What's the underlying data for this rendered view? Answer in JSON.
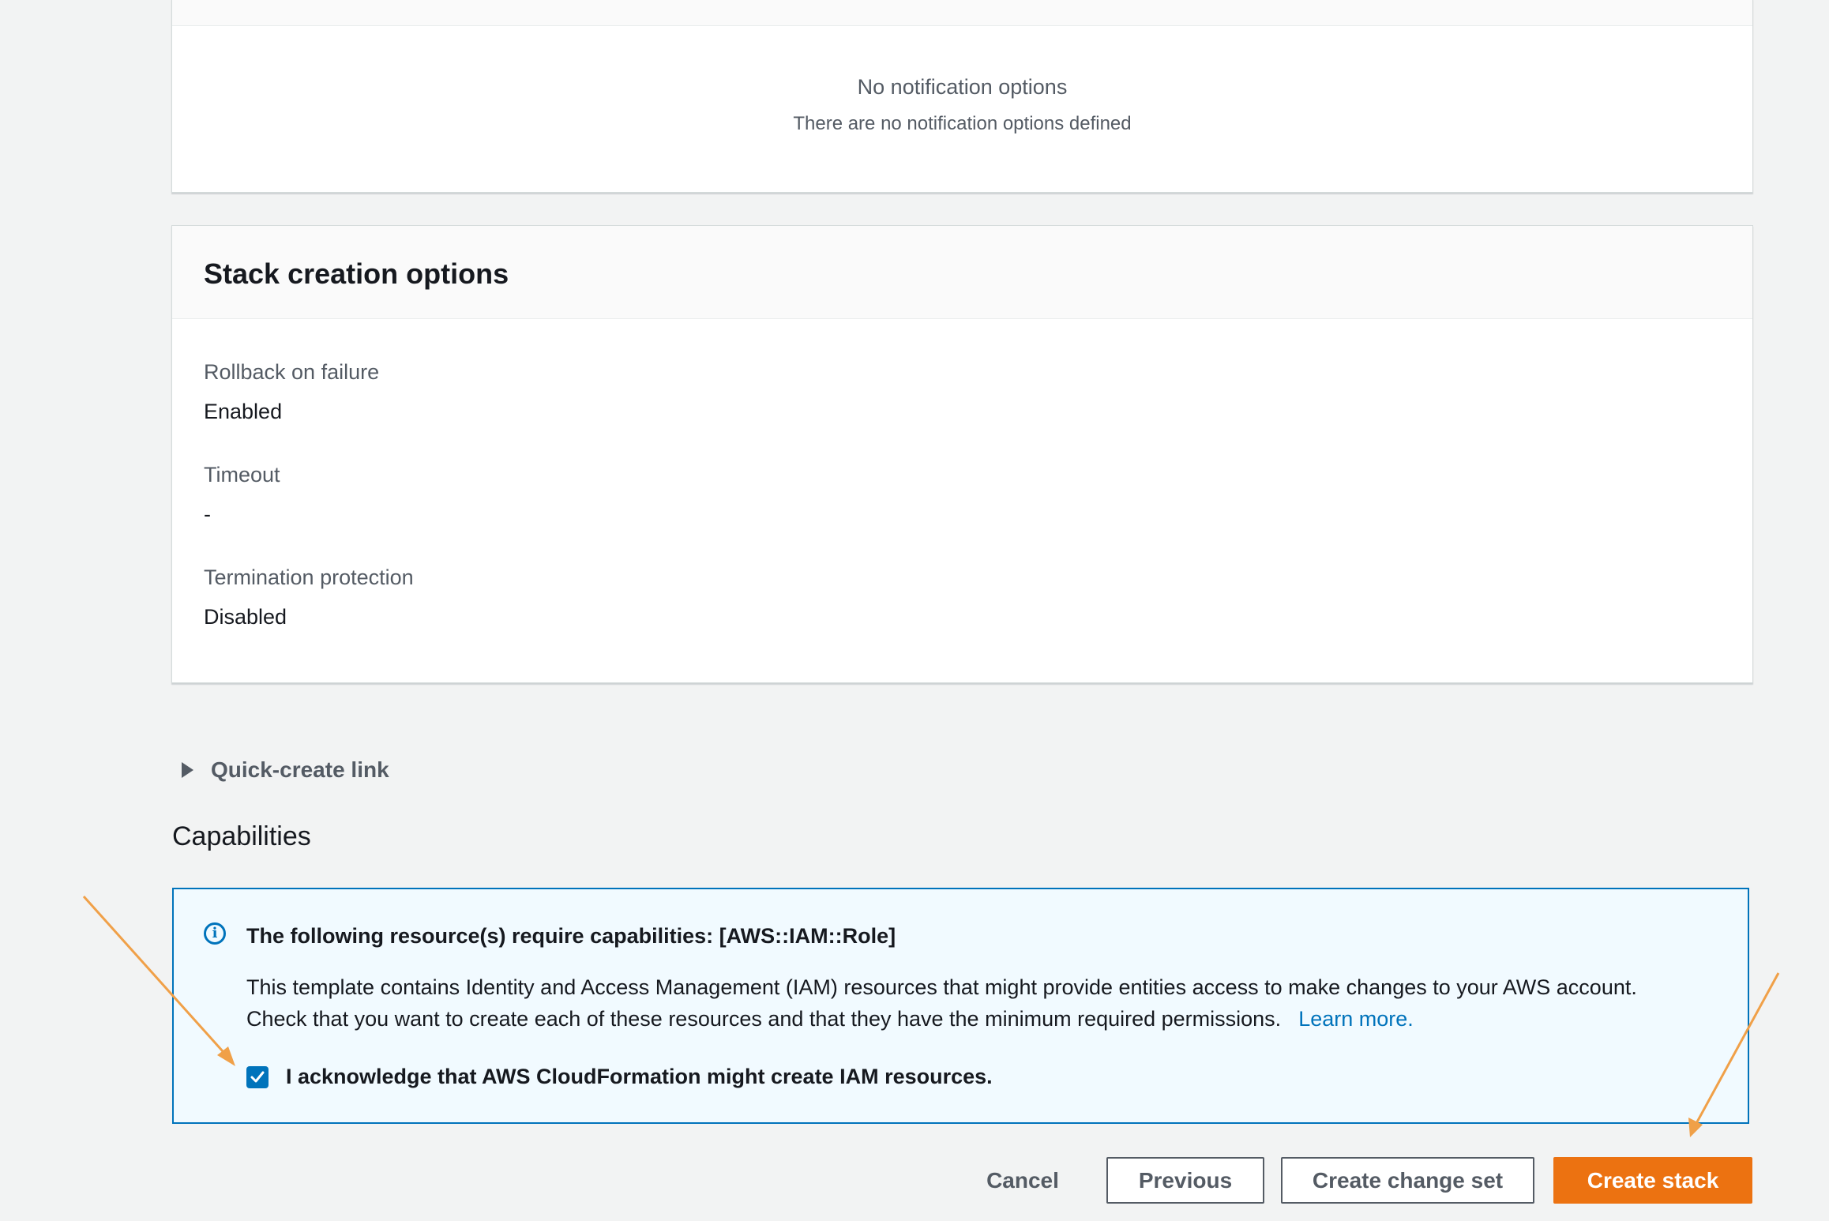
{
  "notifications": {
    "empty_title": "No notification options",
    "empty_subtitle": "There are no notification options defined"
  },
  "stack_creation": {
    "title": "Stack creation options",
    "fields": [
      {
        "label": "Rollback on failure",
        "value": "Enabled"
      },
      {
        "label": "Timeout",
        "value": "-"
      },
      {
        "label": "Termination protection",
        "value": "Disabled"
      }
    ]
  },
  "quick_create": {
    "label": "Quick-create link"
  },
  "capabilities": {
    "heading": "Capabilities",
    "alert_title": "The following resource(s) require capabilities: [AWS::IAM::Role]",
    "alert_body_line1": "This template contains Identity and Access Management (IAM) resources that might provide entities access to make changes to your AWS account.",
    "alert_body_line2": "Check that you want to create each of these resources and that they have the minimum required permissions.",
    "learn_more": "Learn more.",
    "ack_label": "I acknowledge that AWS CloudFormation might create IAM resources.",
    "ack_checked": true
  },
  "footer": {
    "cancel": "Cancel",
    "previous": "Previous",
    "create_change_set": "Create change set",
    "create_stack": "Create stack"
  },
  "colors": {
    "primary_button": "#ec7211",
    "info_blue": "#0073bb",
    "annotation_arrow": "#f0a048"
  }
}
